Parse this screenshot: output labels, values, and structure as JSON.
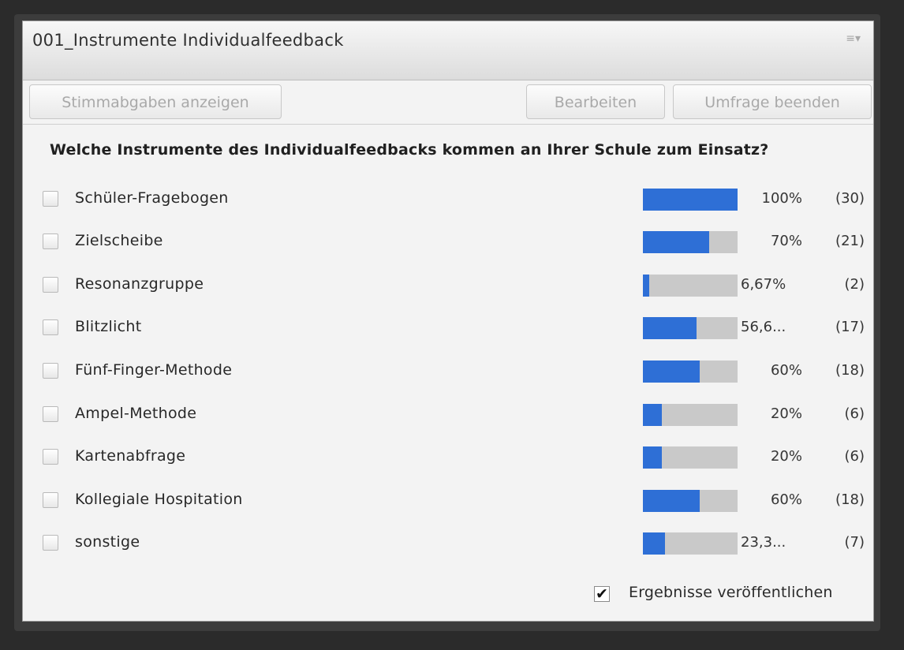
{
  "panel": {
    "title": "001_Instrumente Individualfeedback",
    "menu_icon": "≡▾"
  },
  "toolbar": {
    "show_votes_label": "Stimmabgaben anzeigen",
    "edit_label": "Bearbeiten",
    "end_poll_label": "Umfrage beenden"
  },
  "question": "Welche Instrumente des Individualfeedbacks kommen an Ihrer Schule zum Einsatz?",
  "accent_color": "#2e6fd6",
  "answers": [
    {
      "label": "Schüler-Fragebogen",
      "percent_text": "100%",
      "count_text": "(30)",
      "fraction": 1.0
    },
    {
      "label": "Zielscheibe",
      "percent_text": "70%",
      "count_text": "(21)",
      "fraction": 0.7
    },
    {
      "label": "Resonanzgruppe",
      "percent_text": "6,67%",
      "count_text": "(2)",
      "fraction": 0.0667
    },
    {
      "label": "Blitzlicht",
      "percent_text": "56,6...",
      "count_text": "(17)",
      "fraction": 0.566
    },
    {
      "label": "Fünf-Finger-Methode",
      "percent_text": "60%",
      "count_text": "(18)",
      "fraction": 0.6
    },
    {
      "label": "Ampel-Methode",
      "percent_text": "20%",
      "count_text": "(6)",
      "fraction": 0.2
    },
    {
      "label": "Kartenabfrage",
      "percent_text": "20%",
      "count_text": "(6)",
      "fraction": 0.2
    },
    {
      "label": "Kollegiale Hospitation",
      "percent_text": "60%",
      "count_text": "(18)",
      "fraction": 0.6
    },
    {
      "label": "sonstige",
      "percent_text": "23,3...",
      "count_text": "(7)",
      "fraction": 0.233
    }
  ],
  "publish": {
    "label": "Ergebnisse veröffentlichen",
    "checked": true
  }
}
